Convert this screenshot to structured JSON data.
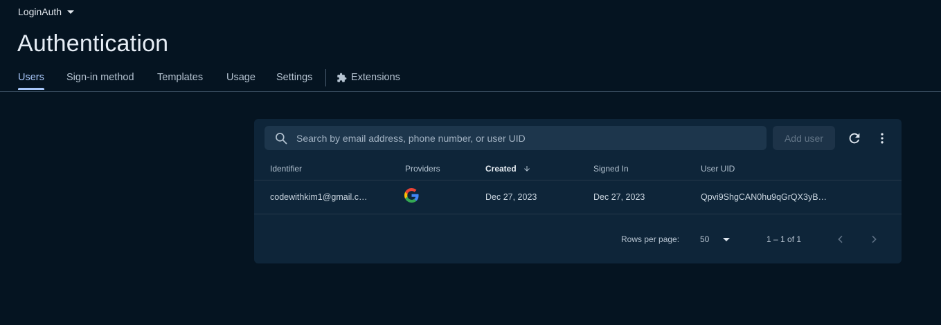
{
  "project": {
    "name": "LoginAuth",
    "icon": "caret-down-icon"
  },
  "page_title": "Authentication",
  "tabs": [
    {
      "label": "Users",
      "active": true
    },
    {
      "label": "Sign-in method"
    },
    {
      "label": "Templates"
    },
    {
      "label": "Usage"
    },
    {
      "label": "Settings"
    },
    {
      "label": "Extensions",
      "icon": "extensions-icon"
    }
  ],
  "toolbar": {
    "search_placeholder": "Search by email address, phone number, or user UID",
    "add_user_label": "Add user",
    "refresh_icon": "refresh-icon",
    "more_icon": "more-vert-icon"
  },
  "table": {
    "columns": [
      "Identifier",
      "Providers",
      "Created",
      "Signed In",
      "User UID"
    ],
    "sorted_column": "Created",
    "sort_direction": "descending",
    "rows": [
      {
        "identifier": "codewithkim1@gmail.c…",
        "provider_icon": "google-icon",
        "created": "Dec 27, 2023",
        "signed_in": "Dec 27, 2023",
        "uid": "Qpvi9ShgCAN0hu9qGrQX3yB…"
      }
    ]
  },
  "pagination": {
    "rows_per_page_label": "Rows per page:",
    "rows_per_page": "50",
    "range": "1 – 1 of 1"
  },
  "colors": {
    "background": "#051421",
    "card": "#0e2539",
    "accent": "#a8c7fa"
  }
}
